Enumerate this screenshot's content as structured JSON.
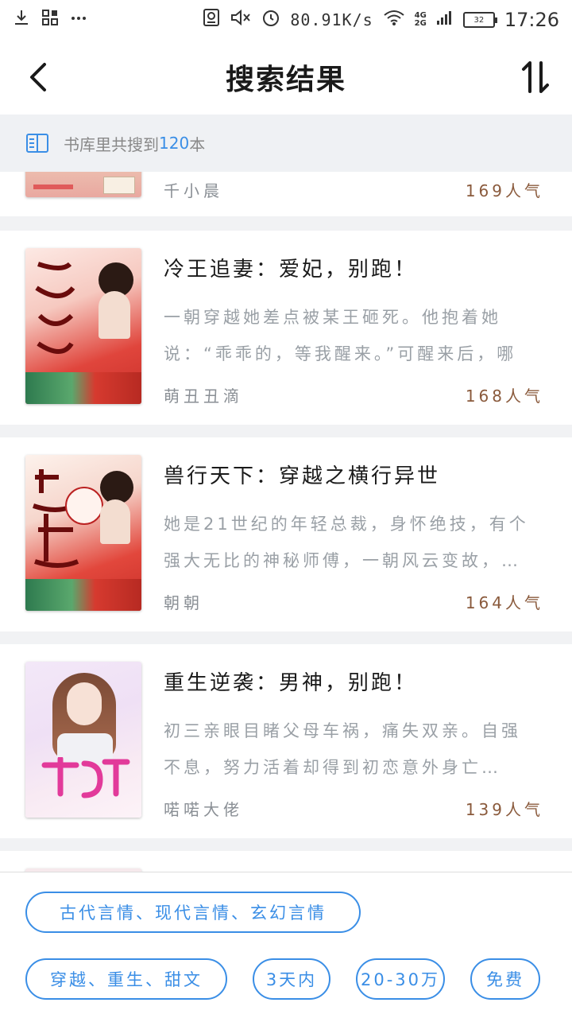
{
  "status_bar": {
    "speed": "80.91K/s",
    "net_top": "4G",
    "net_bottom": "2G",
    "battery": "32",
    "time": "17:26"
  },
  "nav": {
    "title": "搜索结果"
  },
  "count_bar": {
    "prefix": "书库里共搜到",
    "count": "120",
    "suffix": "本"
  },
  "books": [
    {
      "title": "",
      "desc": "",
      "author": "千小晨",
      "popularity": "169人气"
    },
    {
      "title": "冷王追妻：爱妃，别跑！",
      "desc": "一朝穿越她差点被某王砸死。他抱着她说：“乖乖的，等我醒来。”可醒来后，哪还…",
      "author": "萌丑丑滴",
      "popularity": "168人气"
    },
    {
      "title": "兽行天下：穿越之横行异世",
      "desc": "她是21世纪的年轻总裁，身怀绝技，有个强大无比的神秘师傅，一朝风云变故，…",
      "author": "朝朝",
      "popularity": "164人气"
    },
    {
      "title": "重生逆袭：男神，别跑！",
      "desc": "初三亲眼目睹父母车祸，痛失双亲。自强不息，努力活着却得到初恋意外身亡…",
      "author": "喏喏大佬",
      "popularity": "139人气"
    }
  ],
  "tags": [
    "古代言情、现代言情、玄幻言情",
    "穿越、重生、甜文",
    "3天内",
    "20-30万",
    "免费"
  ],
  "colors": {
    "accent": "#3a8ee6",
    "popularity": "#8a5a3c"
  }
}
